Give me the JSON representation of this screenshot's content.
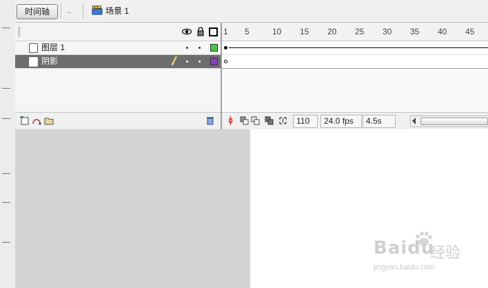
{
  "toolbar": {
    "timeline_button": "时间轴",
    "scene_label": "场景 1"
  },
  "layer_header": {
    "icons": [
      "eye-icon",
      "lock-icon",
      "outline-icon"
    ]
  },
  "layers": [
    {
      "name": "图层 1",
      "selected": false,
      "outline_color": "#46c846"
    },
    {
      "name": "阴影",
      "selected": true,
      "outline_color": "#8a3fc0"
    }
  ],
  "ruler": {
    "labels": [
      "1",
      "5",
      "10",
      "15",
      "20",
      "25",
      "30",
      "35",
      "40",
      "45"
    ]
  },
  "frame_footer": {
    "current_frame": "110",
    "frame_rate": "24.0 fps",
    "elapsed_time": "4.5s"
  },
  "watermark": {
    "brand": "Baidu",
    "chinese": "经验",
    "url": "jingyan.baidu.com"
  },
  "colors": {
    "selected_row": "#6d6d6d",
    "stage": "#ffffff",
    "pasteboard": "#d3d3d3"
  }
}
